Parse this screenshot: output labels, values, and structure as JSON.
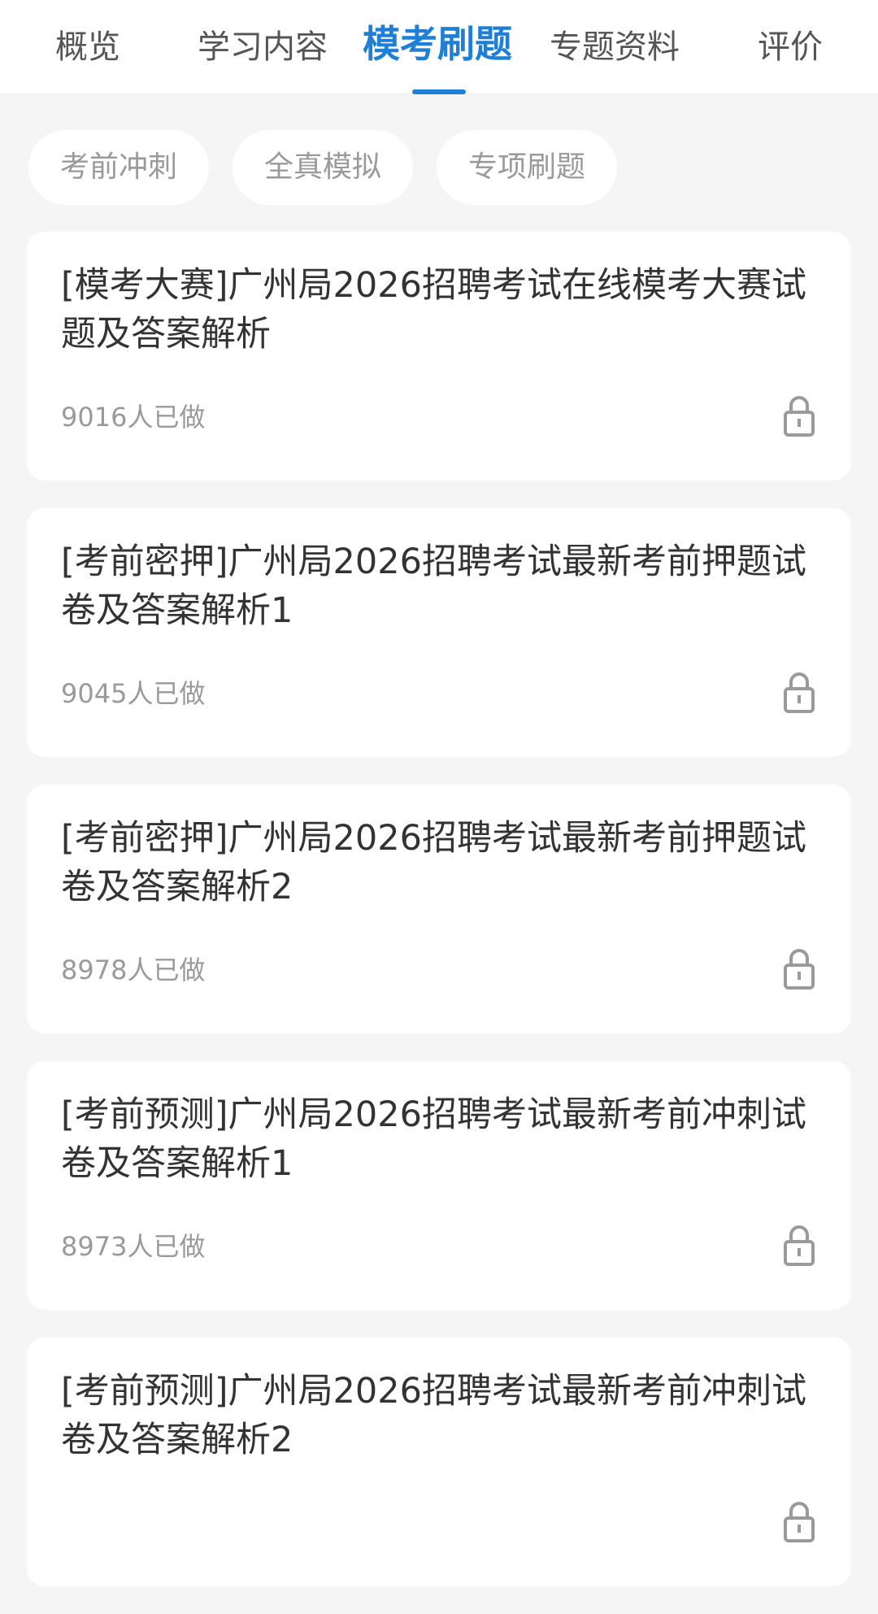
{
  "tabs": [
    {
      "label": "概览",
      "active": false
    },
    {
      "label": "学习内容",
      "active": false
    },
    {
      "label": "模考刷题",
      "active": true
    },
    {
      "label": "专题资料",
      "active": false
    },
    {
      "label": "评价",
      "active": false
    }
  ],
  "filters": [
    "考前冲刺",
    "全真模拟",
    "专项刷题"
  ],
  "items": [
    {
      "title": "[模考大赛]广州局2026招聘考试在线模考大赛试题及答案解析",
      "count": "9016人已做",
      "icon": "lock-icon"
    },
    {
      "title": "[考前密押]广州局2026招聘考试最新考前押题试卷及答案解析1",
      "count": "9045人已做",
      "icon": "lock-icon"
    },
    {
      "title": "[考前密押]广州局2026招聘考试最新考前押题试卷及答案解析2",
      "count": "8978人已做",
      "icon": "lock-icon"
    },
    {
      "title": "[考前预测]广州局2026招聘考试最新考前冲刺试卷及答案解析1",
      "count": "8973人已做",
      "icon": "lock-icon"
    },
    {
      "title": "[考前预测]广州局2026招聘考试最新考前冲刺试卷及答案解析2",
      "count": "",
      "icon": "lock-icon"
    }
  ],
  "colors": {
    "accent": "#1f7fd6",
    "background": "#f5f5f5",
    "card": "#ffffff",
    "muted_text": "#9a9a9a"
  }
}
